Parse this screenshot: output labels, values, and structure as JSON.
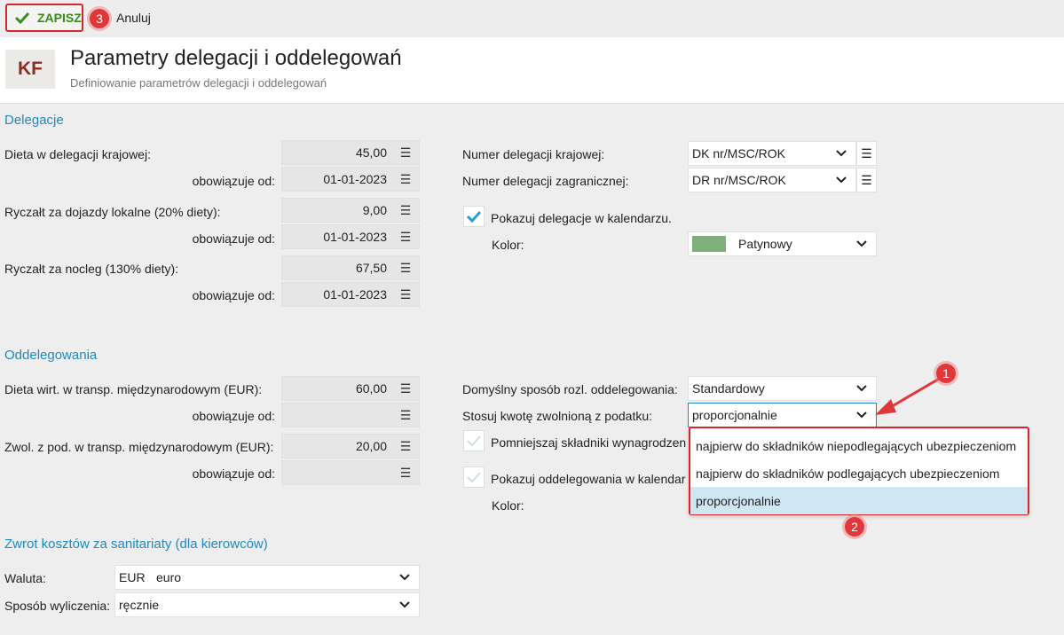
{
  "toolbar": {
    "save_label": "ZAPISZ",
    "cancel_label": "Anuluj",
    "badge": "3"
  },
  "header": {
    "logo": "KF",
    "title": "Parametry delegacji i oddelegowań",
    "subtitle": "Definiowanie parametrów delegacji i oddelegowań"
  },
  "delegacje": {
    "title": "Delegacje",
    "dieta_label": "Dieta w delegacji krajowej:",
    "dieta_value": "45,00",
    "valid_from_label": "obowiązuje od:",
    "dieta_date": "01-01-2023",
    "ryczalt_dojazdy_label": "Ryczałt za dojazdy lokalne (20% diety):",
    "ryczalt_dojazdy_value": "9,00",
    "ryczalt_dojazdy_date": "01-01-2023",
    "ryczalt_nocleg_label": "Ryczałt za nocleg (130% diety):",
    "ryczalt_nocleg_value": "67,50",
    "ryczalt_nocleg_date": "01-01-2023",
    "numer_krajowej_label": "Numer delegacji krajowej:",
    "numer_krajowej_value": "DK nr/MSC/ROK",
    "numer_zagr_label": "Numer delegacji zagranicznej:",
    "numer_zagr_value": "DR nr/MSC/ROK",
    "pokazuj_label": "Pokazuj delegacje w kalendarzu.",
    "kolor_label": "Kolor:",
    "kolor_value": "Patynowy",
    "kolor_hex": "#7fb07a"
  },
  "oddelegowania": {
    "title": "Oddelegowania",
    "dieta_wirt_label": "Dieta wirt. w transp. międzynarodowym (EUR):",
    "dieta_wirt_value": "60,00",
    "valid_from_label": "obowiązuje od:",
    "zwol_label": "Zwol. z pod. w transp. międzynarodowym (EUR):",
    "zwol_value": "20,00",
    "sposob_label": "Domyślny sposób rozl. oddelegowania:",
    "sposob_value": "Standardowy",
    "kwota_label": "Stosuj kwotę zwolnioną z podatku:",
    "kwota_value": "proporcjonalnie",
    "pomniejszaj_label": "Pomniejszaj składniki wynagrodzen",
    "pokazuj_label": "Pokazuj oddelegowania w kalendar",
    "kolor_label": "Kolor:",
    "dropdown_options": [
      "najpierw do składników niepodlegających ubezpieczeniom",
      "najpierw do składników podlegających ubezpieczeniom",
      "proporcjonalnie"
    ],
    "badge_1": "1",
    "badge_2": "2"
  },
  "zwrot": {
    "title": "Zwrot kosztów za sanitariaty (dla kierowców)",
    "waluta_label": "Waluta:",
    "waluta_code": "EUR",
    "waluta_name": "euro",
    "sposob_label": "Sposób wyliczenia:",
    "sposob_value": "ręcznie"
  },
  "colors": {
    "accent": "#1f8ac0",
    "highlight": "#d9242b",
    "save_green": "#3a8a1e",
    "check_blue": "#2b9bd6"
  }
}
